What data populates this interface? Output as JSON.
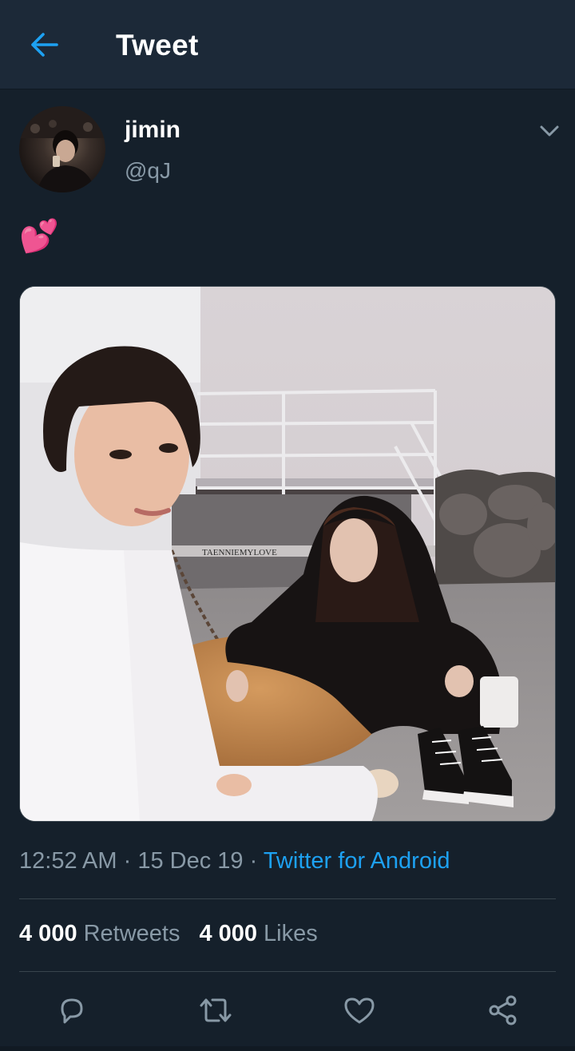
{
  "header": {
    "title": "Tweet",
    "back_icon": "arrow-left-icon",
    "accent": "#1da1f2"
  },
  "tweet": {
    "author": {
      "display_name": "jimin",
      "handle": "@qJ"
    },
    "menu_icon": "chevron-down-icon",
    "text": "💕",
    "media": {
      "watermark": "TAENNIEMYLOVE"
    },
    "time": "12:52 AM",
    "date": "15 Dec 19",
    "separator": "·",
    "source": "Twitter for Android",
    "stats": {
      "retweets_count": "4 000",
      "retweets_label": "Retweets",
      "likes_count": "4 000",
      "likes_label": "Likes"
    },
    "actions": [
      "reply-icon",
      "retweet-icon",
      "like-icon",
      "share-icon"
    ]
  },
  "colors": {
    "background": "#15202b",
    "header_bg": "#1c2938",
    "muted_text": "#8899a6",
    "link": "#1da1f2",
    "divider": "#38444d"
  }
}
